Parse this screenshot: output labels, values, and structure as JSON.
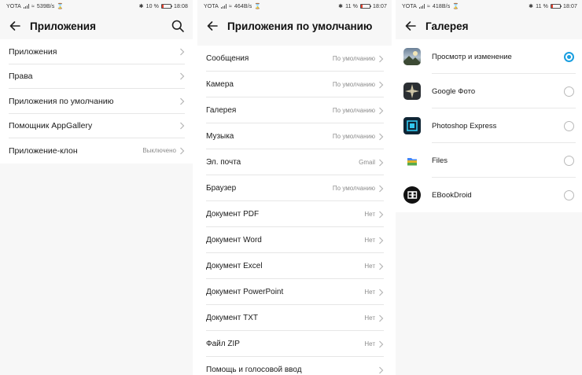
{
  "panel1": {
    "status": {
      "carrier": "YOTA",
      "speed": "539B/s",
      "battery": "10 %",
      "time": "18:08"
    },
    "title": "Приложения",
    "items": [
      {
        "label": "Приложения",
        "value": ""
      },
      {
        "label": "Права",
        "value": ""
      },
      {
        "label": "Приложения по умолчанию",
        "value": ""
      },
      {
        "label": "Помощник AppGallery",
        "value": ""
      },
      {
        "label": "Приложение-клон",
        "value": "Выключено"
      }
    ]
  },
  "panel2": {
    "status": {
      "carrier": "YOTA",
      "speed": "464B/s",
      "battery": "11 %",
      "time": "18:07"
    },
    "title": "Приложения по умолчанию",
    "items": [
      {
        "label": "Сообщения",
        "value": "По умолчанию"
      },
      {
        "label": "Камера",
        "value": "По умолчанию"
      },
      {
        "label": "Галерея",
        "value": "По умолчанию"
      },
      {
        "label": "Музыка",
        "value": "По умолчанию"
      },
      {
        "label": "Эл. почта",
        "value": "Gmail"
      },
      {
        "label": "Браузер",
        "value": "По умолчанию"
      },
      {
        "label": "Документ PDF",
        "value": "Нет"
      },
      {
        "label": "Документ Word",
        "value": "Нет"
      },
      {
        "label": "Документ Excel",
        "value": "Нет"
      },
      {
        "label": "Документ PowerPoint",
        "value": "Нет"
      },
      {
        "label": "Документ TXT",
        "value": "Нет"
      },
      {
        "label": "Файл ZIP",
        "value": "Нет"
      },
      {
        "label": "Помощь и голосовой ввод",
        "value": ""
      }
    ]
  },
  "panel3": {
    "status": {
      "carrier": "YOTA",
      "speed": "418B/s",
      "battery": "11 %",
      "time": "18:07"
    },
    "title": "Галерея",
    "apps": [
      {
        "name": "Просмотр и изменение",
        "icon": "gallery-icon",
        "selected": true
      },
      {
        "name": "Google Фото",
        "icon": "google-photos-icon",
        "selected": false
      },
      {
        "name": "Photoshop Express",
        "icon": "photoshop-express-icon",
        "selected": false
      },
      {
        "name": "Files",
        "icon": "files-icon",
        "selected": false
      },
      {
        "name": "EBookDroid",
        "icon": "ebookdroid-icon",
        "selected": false
      }
    ]
  },
  "colors": {
    "accent": "#1a9fe0",
    "battery_low": "#e4402f"
  }
}
